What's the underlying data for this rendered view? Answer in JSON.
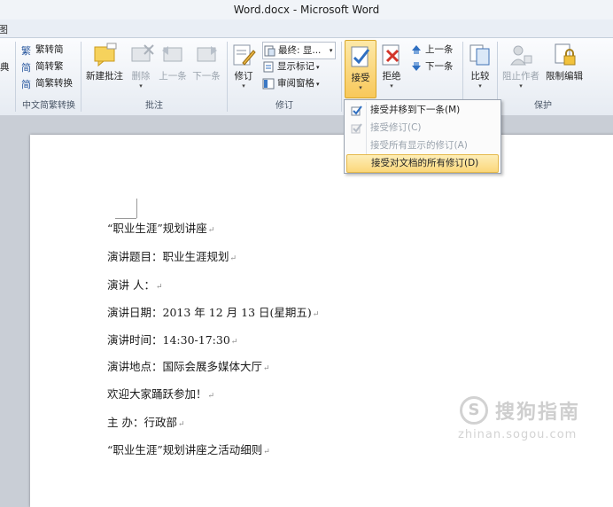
{
  "window": {
    "title": "Word.docx - Microsoft Word"
  },
  "tabs": {
    "clipped_left": "图"
  },
  "ribbon": {
    "clipped_left_label": "典",
    "chinese_conversion": {
      "items": [
        "繁转简",
        "简转繁",
        "简繁转换"
      ],
      "label": "中文简繁转换"
    },
    "comments": {
      "new_comment": "新建批注",
      "delete": "删除",
      "previous": "上一条",
      "next": "下一条",
      "label": "批注"
    },
    "tracking": {
      "track_changes": "修订",
      "display_mode": "最终: 显...",
      "show_markup": "显示标记",
      "reviewing_pane": "审阅窗格",
      "label": "修订"
    },
    "changes": {
      "accept": "接受",
      "reject": "拒绝",
      "previous": "上一条",
      "next": "下一条"
    },
    "compare": {
      "compare": "比较"
    },
    "protect": {
      "block_authors": "阻止作者",
      "restrict_editing": "限制编辑",
      "label": "保护"
    }
  },
  "accept_menu": {
    "items": [
      {
        "label": "接受并移到下一条(M)",
        "enabled": true
      },
      {
        "label": "接受修订(C)",
        "enabled": false
      },
      {
        "label": "接受所有显示的修订(A)",
        "enabled": false
      },
      {
        "label": "接受对文档的所有修订(D)",
        "enabled": true,
        "highlighted": true
      }
    ]
  },
  "document": {
    "lines": [
      "“职业生涯”规划讲座",
      "演讲题目：职业生涯规划",
      "演讲 人：",
      "演讲日期：2013 年 12 月 13 日(星期五)",
      "演讲时间：14:30-17:30",
      "演讲地点：国际会展多媒体大厅",
      "欢迎大家踊跃参加！",
      "主 办：行政部",
      "“职业生涯”规划讲座之活动细则"
    ],
    "paragraph_mark": "↵"
  },
  "watermark": {
    "main": "搜狗指南",
    "sub": "zhinan.sogou.com"
  },
  "colors": {
    "accent_highlight": "#fbd77a",
    "ribbon_bg": "#e6ebf2",
    "doc_bg": "#c9ced6"
  }
}
